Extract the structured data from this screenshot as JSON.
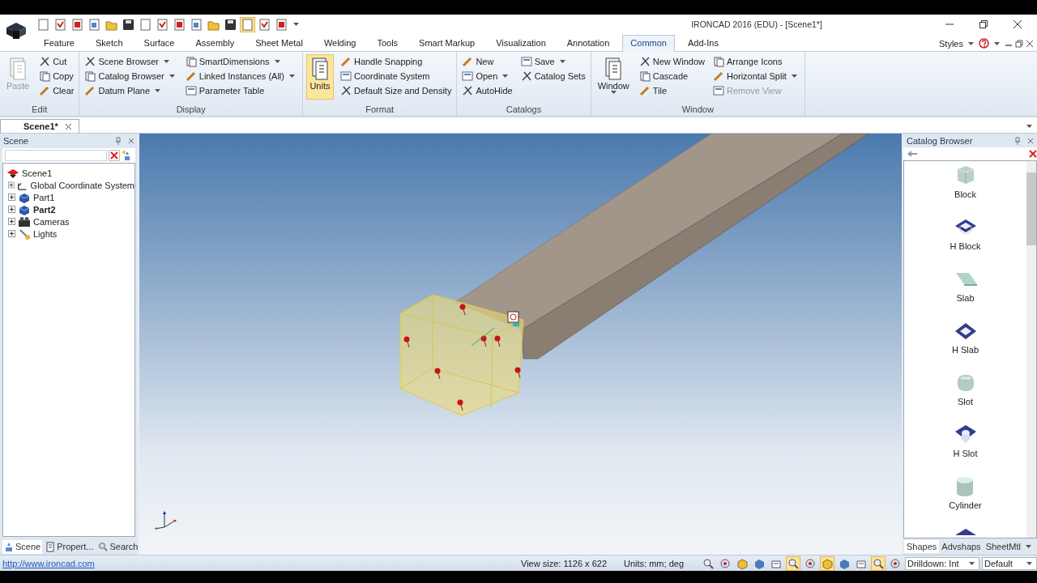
{
  "window": {
    "title": "IRONCAD 2016 (EDU) - [Scene1*]"
  },
  "quick_access": [
    {
      "on": false
    },
    {
      "on": false
    },
    {
      "on": false
    },
    {
      "on": false
    },
    {
      "on": false
    },
    {
      "on": false
    },
    {
      "on": false
    },
    {
      "on": false
    },
    {
      "on": false
    },
    {
      "on": false
    },
    {
      "on": false
    },
    {
      "on": false
    },
    {
      "on": true
    },
    {
      "on": false
    },
    {
      "on": false
    }
  ],
  "ribbon_tabs": [
    {
      "label": "Feature",
      "selected": false
    },
    {
      "label": "Sketch",
      "selected": false
    },
    {
      "label": "Surface",
      "selected": false
    },
    {
      "label": "Assembly",
      "selected": false
    },
    {
      "label": "Sheet Metal",
      "selected": false
    },
    {
      "label": "Welding",
      "selected": false
    },
    {
      "label": "Tools",
      "selected": false
    },
    {
      "label": "Smart Markup",
      "selected": false
    },
    {
      "label": "Visualization",
      "selected": false
    },
    {
      "label": "Annotation",
      "selected": false
    },
    {
      "label": "Common",
      "selected": true
    },
    {
      "label": "Add-Ins",
      "selected": false
    }
  ],
  "styles_menu": {
    "label": "Styles"
  },
  "ribbon_groups": [
    {
      "name": "Edit",
      "columns": [
        [
          {
            "kind": "large",
            "label": "Paste",
            "dropdown": false,
            "disabled": true,
            "selected": false
          }
        ],
        [
          {
            "kind": "small",
            "label": "Cut",
            "dropdown": false,
            "disabled": false
          },
          {
            "kind": "small",
            "label": "Copy",
            "dropdown": false,
            "disabled": false
          },
          {
            "kind": "small",
            "label": "Clear",
            "dropdown": false,
            "disabled": false
          }
        ]
      ]
    },
    {
      "name": "Display",
      "columns": [
        [
          {
            "kind": "small",
            "label": "Scene Browser",
            "dropdown": true,
            "disabled": false
          },
          {
            "kind": "small",
            "label": "Catalog Browser",
            "dropdown": true,
            "disabled": false
          },
          {
            "kind": "small",
            "label": "Datum Plane",
            "dropdown": true,
            "disabled": false
          }
        ],
        [
          {
            "kind": "small",
            "label": "SmartDimensions",
            "dropdown": true,
            "disabled": false
          },
          {
            "kind": "small",
            "label": "Linked Instances (All)",
            "dropdown": true,
            "disabled": false
          },
          {
            "kind": "small",
            "label": "Parameter Table",
            "dropdown": false,
            "disabled": false
          }
        ]
      ]
    },
    {
      "name": "Format",
      "columns": [
        [
          {
            "kind": "large",
            "label": "Units",
            "dropdown": false,
            "disabled": false,
            "selected": true
          }
        ],
        [
          {
            "kind": "small",
            "label": "Handle Snapping",
            "dropdown": false,
            "disabled": false
          },
          {
            "kind": "small",
            "label": "Coordinate System",
            "dropdown": false,
            "disabled": false
          },
          {
            "kind": "small",
            "label": "Default Size and Density",
            "dropdown": false,
            "disabled": false
          }
        ]
      ]
    },
    {
      "name": "Catalogs",
      "columns": [
        [
          {
            "kind": "small",
            "label": "New",
            "dropdown": false,
            "disabled": false
          },
          {
            "kind": "small",
            "label": "Open",
            "dropdown": true,
            "disabled": false
          },
          {
            "kind": "small",
            "label": "AutoHide",
            "dropdown": false,
            "disabled": false
          }
        ],
        [
          {
            "kind": "small",
            "label": "Save",
            "dropdown": true,
            "disabled": false
          },
          {
            "kind": "small",
            "label": "Catalog Sets",
            "dropdown": false,
            "disabled": false
          }
        ]
      ]
    },
    {
      "name": "Window",
      "columns": [
        [
          {
            "kind": "large",
            "label": "Window",
            "dropdown": true,
            "disabled": false,
            "selected": false
          }
        ],
        [
          {
            "kind": "small",
            "label": "New Window",
            "dropdown": false,
            "disabled": false
          },
          {
            "kind": "small",
            "label": "Cascade",
            "dropdown": false,
            "disabled": false
          },
          {
            "kind": "small",
            "label": "Tile",
            "dropdown": false,
            "disabled": false
          }
        ],
        [
          {
            "kind": "small",
            "label": "Arrange Icons",
            "dropdown": false,
            "disabled": false
          },
          {
            "kind": "small",
            "label": "Horizontal Split",
            "dropdown": true,
            "disabled": false
          },
          {
            "kind": "small",
            "label": "Remove View",
            "dropdown": false,
            "disabled": true
          }
        ]
      ]
    }
  ],
  "document_tabs": [
    {
      "label": "Scene1*",
      "selected": true
    }
  ],
  "scene_panel": {
    "title": "Scene",
    "tree": [
      {
        "label": "Scene1",
        "bold": false,
        "children": [
          {
            "label": "Global Coordinate System",
            "bold": false,
            "expanded": false
          },
          {
            "label": "Part1",
            "bold": false,
            "expanded": false
          },
          {
            "label": "Part2",
            "bold": true,
            "expanded": false
          },
          {
            "label": "Cameras",
            "bold": false,
            "expanded": false
          },
          {
            "label": "Lights",
            "bold": false,
            "expanded": false
          }
        ]
      }
    ],
    "tabs": [
      {
        "label": "Scene",
        "selected": true
      },
      {
        "label": "Propert...",
        "selected": false
      },
      {
        "label": "Search",
        "selected": false
      }
    ]
  },
  "catalog_browser": {
    "title": "Catalog Browser",
    "items": [
      {
        "label": "Block",
        "kind": "block"
      },
      {
        "label": "H Block",
        "kind": "hblock"
      },
      {
        "label": "Slab",
        "kind": "slab"
      },
      {
        "label": "H Slab",
        "kind": "hslab"
      },
      {
        "label": "Slot",
        "kind": "slot"
      },
      {
        "label": "H Slot",
        "kind": "hslot"
      },
      {
        "label": "Cylinder",
        "kind": "cylinder"
      }
    ],
    "tabs": [
      {
        "label": "Shapes",
        "selected": true
      },
      {
        "label": "Advshaps",
        "selected": false
      },
      {
        "label": "SheetMtl",
        "selected": false
      }
    ]
  },
  "status_bar": {
    "link": "http://www.ironcad.com",
    "view_size": "View size: 1126 x  622",
    "units": "Units: mm; deg",
    "tools": [
      {
        "on": false
      },
      {
        "on": false
      },
      {
        "on": false
      },
      {
        "on": false
      },
      {
        "on": false
      },
      {
        "on": true
      },
      {
        "on": false
      },
      {
        "on": true
      },
      {
        "on": false
      },
      {
        "on": false
      },
      {
        "on": true
      },
      {
        "on": false
      }
    ],
    "drilldown": "Drilldown: Int",
    "style": "Default"
  }
}
